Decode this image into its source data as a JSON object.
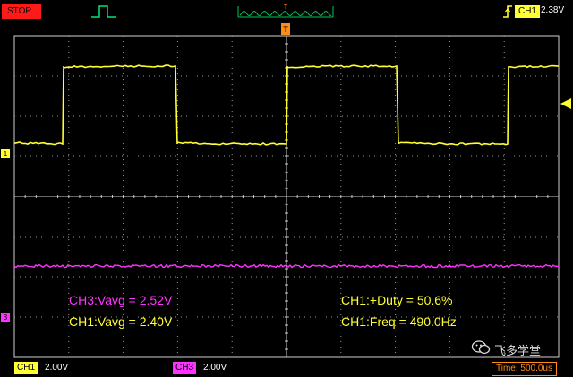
{
  "status": {
    "run_state": "STOP"
  },
  "trigger": {
    "source_label": "CH1",
    "level": "2.38V",
    "marker_label": "T"
  },
  "channels": {
    "ch1": {
      "label": "CH1",
      "scale": "2.00V",
      "marker": "1",
      "color": "#ffff33"
    },
    "ch3": {
      "label": "CH3",
      "scale": "2.00V",
      "marker": "3",
      "color": "#ff33ff"
    }
  },
  "timebase": {
    "label": "Time: 500.0us"
  },
  "measurements": {
    "ch3_vavg": "CH3:Vavg = 2.52V",
    "ch1_vavg": "CH1:Vavg = 2.40V",
    "ch1_duty": "CH1:+Duty = 50.6%",
    "ch1_freq": "CH1:Freq = 490.0Hz"
  },
  "watermark": {
    "text": "飞多学堂",
    "icon": "wechat-icon"
  },
  "icons": {
    "trigger_mode": "single-pulse-icon",
    "trigger_edge": "rising-edge-icon",
    "overview": "waveform-overview-icon"
  }
}
